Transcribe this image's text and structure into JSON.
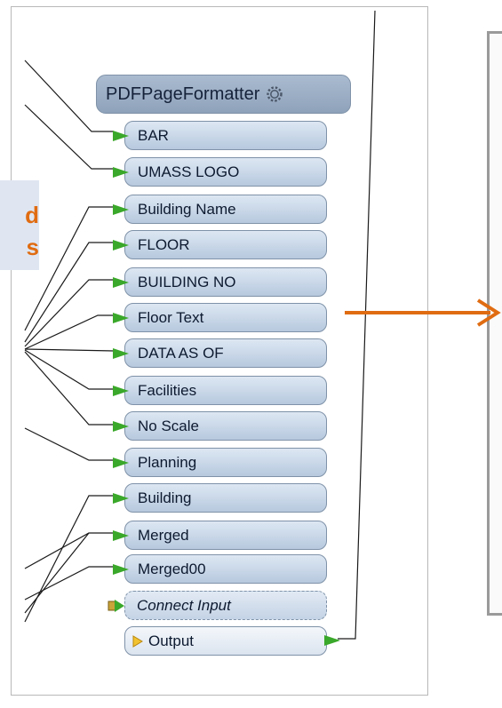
{
  "callout": {
    "line1": "d",
    "line2": "s"
  },
  "transformer": {
    "title": "PDFPageFormatter",
    "ports": [
      "BAR",
      "UMASS LOGO",
      "Building Name",
      "FLOOR",
      "BUILDING NO",
      "Floor Text",
      "DATA AS OF",
      "Facilities",
      "No Scale",
      "Planning",
      "Building",
      "Merged",
      "Merged00"
    ],
    "connect_input": "Connect Input",
    "output": "Output"
  },
  "colors": {
    "accent": "#e06c12",
    "port_arrow": "#3aa82a",
    "callout_bg": "#dfe6f2"
  }
}
